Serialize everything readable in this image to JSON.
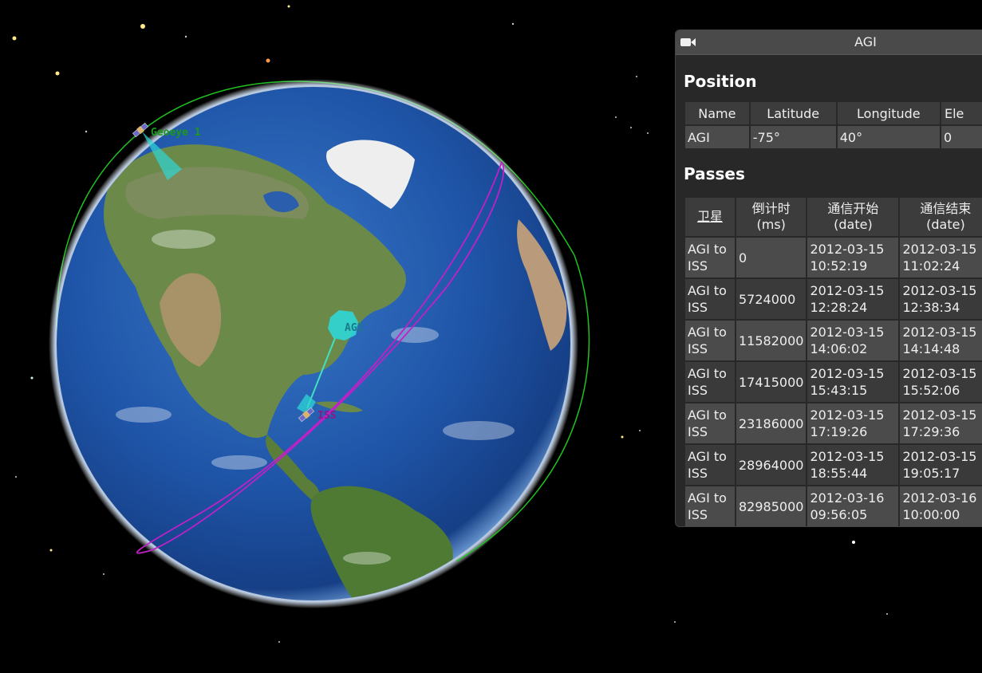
{
  "scene": {
    "satellites": [
      {
        "name": "Geoeye 1"
      },
      {
        "name": "ISS"
      }
    ],
    "ground_station": {
      "name": "AGI"
    },
    "colors": {
      "geoeye_orbit": "#1ec21e",
      "iss_orbit": "#c020c8",
      "sensor_cone": "#2ed6d6",
      "link_line": "#40e0c0",
      "ocean": "#1d4f9c"
    }
  },
  "panel": {
    "title": "AGI",
    "camera_icon": "camera-icon",
    "position": {
      "heading": "Position",
      "headers": [
        "Name",
        "Latitude",
        "Longitude",
        "Ele"
      ],
      "row": [
        "AGI",
        "-75°",
        "40°",
        "0"
      ]
    },
    "passes": {
      "heading": "Passes",
      "headers": [
        {
          "line1": "卫星",
          "line2": ""
        },
        {
          "line1": "倒计时",
          "line2": "(ms)"
        },
        {
          "line1": "通信开始",
          "line2": "(date)"
        },
        {
          "line1": "通信结束",
          "line2": "(date)"
        }
      ],
      "rows": [
        {
          "sat1": "AGI to",
          "sat2": "ISS",
          "countdown": "0",
          "start1": "2012-03-15",
          "start2": "10:52:19",
          "end1": "2012-03-15",
          "end2": "11:02:24"
        },
        {
          "sat1": "AGI to",
          "sat2": "ISS",
          "countdown": "5724000",
          "start1": "2012-03-15",
          "start2": "12:28:24",
          "end1": "2012-03-15",
          "end2": "12:38:34"
        },
        {
          "sat1": "AGI to",
          "sat2": "ISS",
          "countdown": "11582000",
          "start1": "2012-03-15",
          "start2": "14:06:02",
          "end1": "2012-03-15",
          "end2": "14:14:48"
        },
        {
          "sat1": "AGI to",
          "sat2": "ISS",
          "countdown": "17415000",
          "start1": "2012-03-15",
          "start2": "15:43:15",
          "end1": "2012-03-15",
          "end2": "15:52:06"
        },
        {
          "sat1": "AGI to",
          "sat2": "ISS",
          "countdown": "23186000",
          "start1": "2012-03-15",
          "start2": "17:19:26",
          "end1": "2012-03-15",
          "end2": "17:29:36"
        },
        {
          "sat1": "AGI to",
          "sat2": "ISS",
          "countdown": "28964000",
          "start1": "2012-03-15",
          "start2": "18:55:44",
          "end1": "2012-03-15",
          "end2": "19:05:17"
        },
        {
          "sat1": "AGI to",
          "sat2": "ISS",
          "countdown": "82985000",
          "start1": "2012-03-16",
          "start2": "09:56:05",
          "end1": "2012-03-16",
          "end2": "10:00:00"
        }
      ]
    }
  }
}
